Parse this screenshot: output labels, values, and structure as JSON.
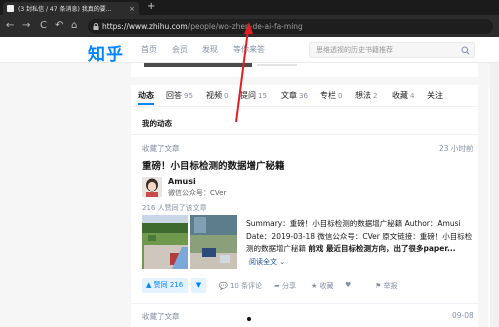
{
  "browser": {
    "tab_title": "(3 封私信 / 47 条消息) 我真的要...",
    "tab_close": "×",
    "new_tab": "+",
    "url_host": "https://www.zhihu.com",
    "url_path": "/people/wo-zhen-de-ai-fa-ming",
    "back": "←",
    "forward": "→",
    "reload": "C",
    "undo": "↶",
    "home": "⌂"
  },
  "header": {
    "logo": "知乎",
    "nav": [
      "首页",
      "会员",
      "发现",
      "等你来答"
    ],
    "search_placeholder": "思维透视的历史书籍推荐",
    "brand_color": "#0084ff"
  },
  "tabs": [
    {
      "label": "动态",
      "count": ""
    },
    {
      "label": "回答",
      "count": "95"
    },
    {
      "label": "视频",
      "count": "0"
    },
    {
      "label": "提问",
      "count": "15"
    },
    {
      "label": "文章",
      "count": "36"
    },
    {
      "label": "专栏",
      "count": "0"
    },
    {
      "label": "想法",
      "count": "2"
    },
    {
      "label": "收藏",
      "count": "4"
    },
    {
      "label": "关注",
      "count": ""
    }
  ],
  "feed": {
    "section_title": "我的动态",
    "item1": {
      "action": "收藏了文章",
      "time": "23 小时前",
      "title": "重磅！小目标检测的数据增广秘籍",
      "author": "Amusi",
      "author_bio": "微信公众号：CVer",
      "likes": "216 人赞同了该文章",
      "summary_plain": "Summary：重磅！小目标检测的数据增广秘籍 Author：Amusi Date：2019-03-18 微信公众号：CVer 原文链接：重磅！小目标检测的数据增广秘籍 ",
      "summary_bold": "前戏 最近目标检测方向，出了很多paper...",
      "read_more": "阅读全文",
      "vote_label": "▲ 赞同 216",
      "vote_down": "▼",
      "comments": "10 条评论",
      "share": "分享",
      "collect": "收藏",
      "report": "举报"
    },
    "item2": {
      "action": "收藏了文章",
      "time": "09-08"
    }
  }
}
